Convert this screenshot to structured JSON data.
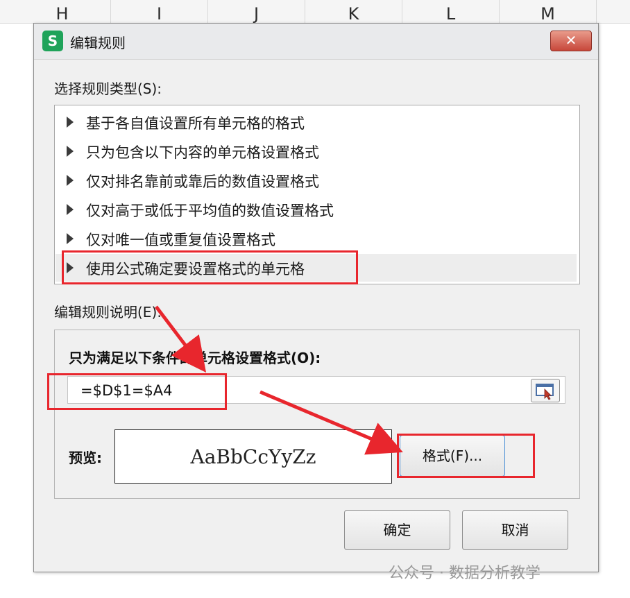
{
  "columns": [
    "H",
    "I",
    "J",
    "K",
    "L",
    "M"
  ],
  "dialog": {
    "title": "编辑规则",
    "app_icon_letter": "S",
    "close_label": "✕",
    "select_type_label": "选择规则类型(S):",
    "rule_types": [
      "基于各自值设置所有单元格的格式",
      "只为包含以下内容的单元格设置格式",
      "仅对排名靠前或靠后的数值设置格式",
      "仅对高于或低于平均值的数值设置格式",
      "仅对唯一值或重复值设置格式",
      "使用公式确定要设置格式的单元格"
    ],
    "selected_rule_index": 5,
    "edit_desc_label": "编辑规则说明(E):",
    "condition_label": "只为满足以下条件的单元格设置格式(O):",
    "formula_value": "=$D$1=$A4",
    "preview_label": "预览:",
    "preview_sample": "AaBbCcYyZz",
    "format_button": "格式(F)...",
    "ok_button": "确定",
    "cancel_button": "取消"
  },
  "watermark": "公众号 · 数据分析教学",
  "colors": {
    "highlight": "#e8262d",
    "app_icon": "#1fa35a",
    "close_button": "#c7473a"
  }
}
